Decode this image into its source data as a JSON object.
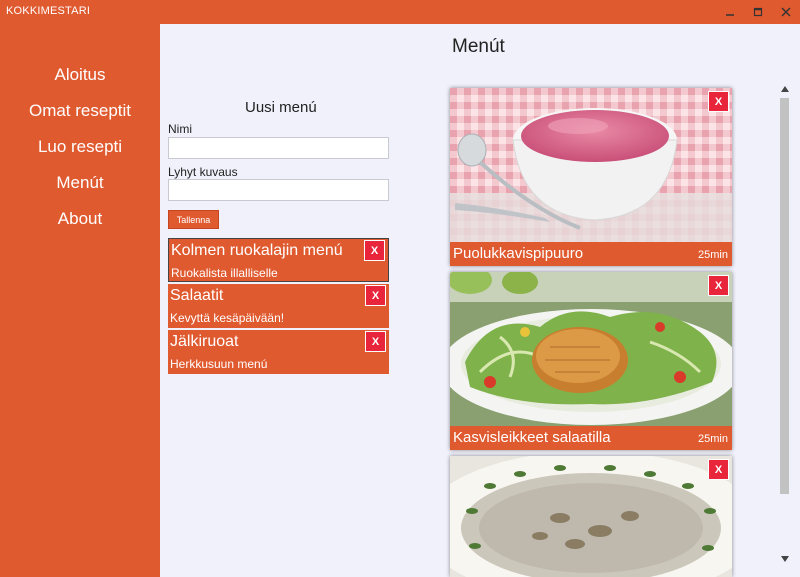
{
  "window": {
    "title": "KOKKIMESTARI",
    "controls": [
      "minimize-icon",
      "maximize-icon",
      "close-icon"
    ]
  },
  "sidebar": {
    "items": [
      {
        "label": "Aloitus"
      },
      {
        "label": "Omat reseptit"
      },
      {
        "label": "Luo resepti"
      },
      {
        "label": "Menút"
      },
      {
        "label": "About"
      }
    ]
  },
  "page": {
    "title": "Menút"
  },
  "form": {
    "title": "Uusi menú",
    "name_label": "Nimi",
    "name_value": "",
    "desc_label": "Lyhyt kuvaus",
    "desc_value": "",
    "save_label": "Tallenna"
  },
  "menus": [
    {
      "name": "Kolmen ruokalajin menú",
      "desc": "Ruokalista illalliselle",
      "selected": true,
      "delete_label": "X"
    },
    {
      "name": "Salaatit",
      "desc": "Kevyttä kesäpäivään!",
      "selected": false,
      "delete_label": "X"
    },
    {
      "name": "Jälkiruoat",
      "desc": "Herkkusuun menú",
      "selected": false,
      "delete_label": "X"
    }
  ],
  "recipes": [
    {
      "name": "Puolukkavispipuuro",
      "time": "25min",
      "delete_label": "X"
    },
    {
      "name": "Kasvisleikkeet salaatilla",
      "time": "25min",
      "delete_label": "X"
    },
    {
      "name": "",
      "time": "",
      "delete_label": "X"
    }
  ],
  "colors": {
    "accent": "#e05a30",
    "delete": "#e8253a",
    "background": "#f1f1fb"
  }
}
